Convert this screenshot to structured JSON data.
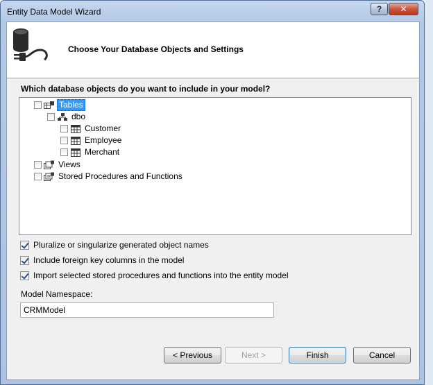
{
  "window": {
    "title": "Entity Data Model Wizard",
    "help_label": "?",
    "close_label": "✕"
  },
  "header": {
    "icon": "database-plug-icon",
    "title": "Choose Your Database Objects and Settings"
  },
  "question": "Which database objects do you want to include in your model?",
  "tree": {
    "tables": {
      "label": "Tables",
      "checked": false,
      "selected": true,
      "icon": "tables-folder-icon"
    },
    "dbo": {
      "label": "dbo",
      "checked": false,
      "icon": "schema-icon"
    },
    "tables_children": [
      {
        "label": "Customer",
        "checked": false,
        "icon": "table-icon"
      },
      {
        "label": "Employee",
        "checked": false,
        "icon": "table-icon"
      },
      {
        "label": "Merchant",
        "checked": false,
        "icon": "table-icon"
      }
    ],
    "views": {
      "label": "Views",
      "checked": false,
      "icon": "views-folder-icon"
    },
    "procs": {
      "label": "Stored Procedures and Functions",
      "checked": false,
      "icon": "procs-folder-icon"
    }
  },
  "options": {
    "pluralize": {
      "label": "Pluralize or singularize generated object names",
      "checked": true
    },
    "foreign_keys": {
      "label": "Include foreign key columns in the model",
      "checked": true
    },
    "import_procs": {
      "label": "Import selected stored procedures and functions into the entity model",
      "checked": true
    }
  },
  "namespace": {
    "label": "Model Namespace:",
    "value": "CRMModel"
  },
  "buttons": {
    "previous": "< Previous",
    "next": "Next >",
    "finish": "Finish",
    "cancel": "Cancel"
  },
  "colors": {
    "selection": "#3399ff",
    "frame": "#aec3e1",
    "close": "#c9563e"
  }
}
